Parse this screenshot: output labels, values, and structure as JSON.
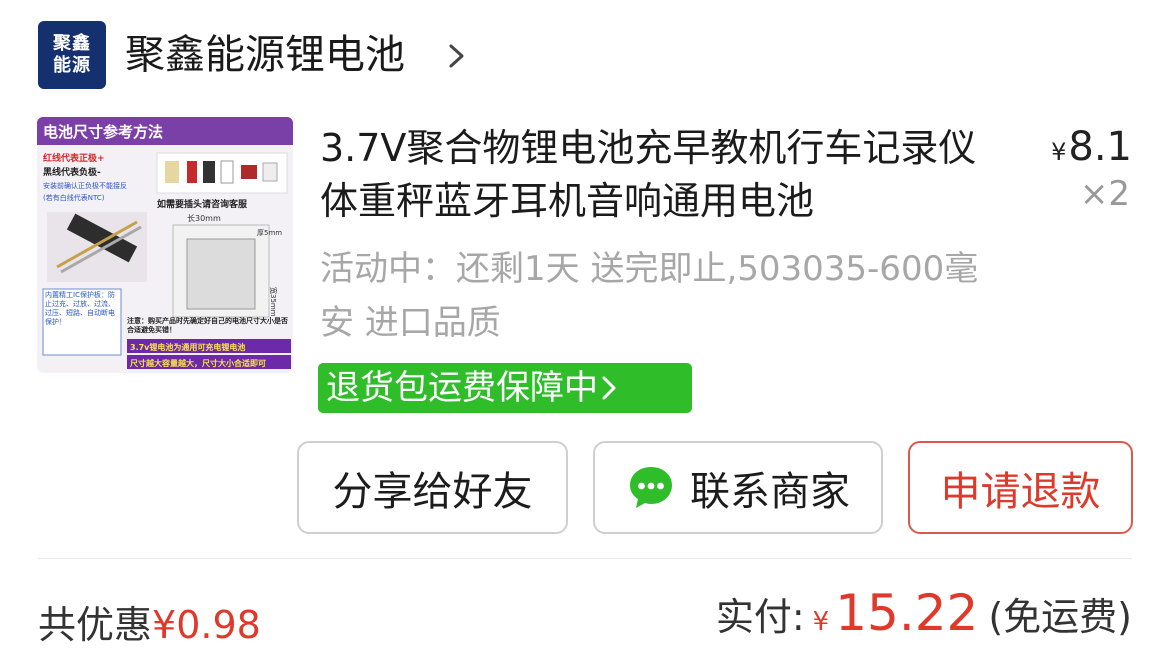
{
  "store": {
    "logo_line1": "聚鑫",
    "logo_line2": "能源",
    "name": "聚鑫能源锂电池",
    "chevron_icon": "chevron-right-icon"
  },
  "product": {
    "thumbnail": {
      "heading": "电池尺寸参考方法",
      "note_red": "红线代表正极+",
      "note_black": "黑线代表负极-",
      "note_blue": "安装前确认正负极不能接反",
      "note_ntc": "(若有白线代表NTC)",
      "plug_note": "如需要插头请咨询客服",
      "dim_length": "长30mm",
      "dim_thickness": "厚5mm",
      "dim_width": "宽35mm",
      "protect_board": "内置精工IC保护板：防止过充、过放、过流、过压、短路、自动断电保护！",
      "attention": "注意：购买产品时先确定好自己的电池尺寸大小是否合适避免买错！",
      "general": "3.7v锂电池为通用可充电锂电池",
      "size_note": "尺寸越大容量越大，尺寸大小合适即可"
    },
    "title": "3.7V聚合物锂电池充早教机行车记录仪体重秤蓝牙耳机音响通用电池",
    "price_symbol": "¥",
    "price": "8.1",
    "quantity": "×2",
    "activity": "活动中：还剩1天 送完即止,503035-600毫安 进口品质",
    "return_badge": "退货包运费保障中"
  },
  "actions": {
    "share": "分享给好友",
    "contact": "联系商家",
    "refund": "申请退款"
  },
  "summary": {
    "discount_label": "共优惠",
    "discount_amount": "¥0.98",
    "paid_label": "实付:",
    "paid_symbol": "¥",
    "paid_amount": "15.22",
    "shipping_note": "(免运费)"
  },
  "colors": {
    "brand_logo": "#14306e",
    "badge_green": "#2fbd2a",
    "accent_red": "#e0382a",
    "wechat_green": "#2fbd2a"
  }
}
